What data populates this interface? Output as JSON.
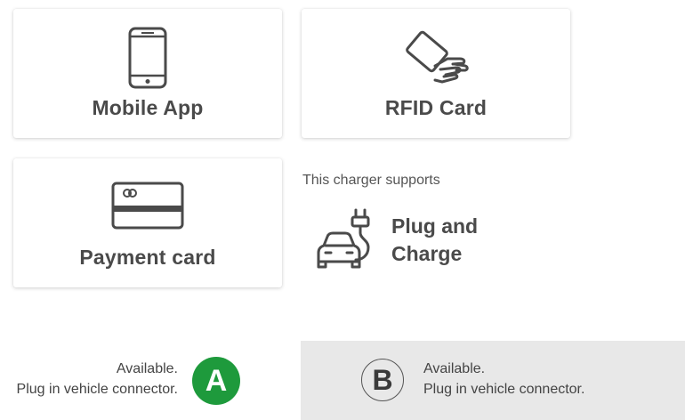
{
  "methods": [
    {
      "id": "mobile",
      "label": "Mobile App",
      "icon": "smartphone-icon"
    },
    {
      "id": "rfid",
      "label": "RFID Card",
      "icon": "rfid-card-tap-icon"
    },
    {
      "id": "payment",
      "label": "Payment card",
      "icon": "credit-card-icon"
    }
  ],
  "supports": {
    "text": "This charger supports",
    "feature_label": "Plug and Charge",
    "icon": "car-plug-icon"
  },
  "connectors": [
    {
      "id": "A",
      "letter": "A",
      "status": "Available.",
      "instruction": "Plug in vehicle connector.",
      "badge_color": "#1e9a3c",
      "selected": true
    },
    {
      "id": "B",
      "letter": "B",
      "status": "Available.",
      "instruction": "Plug in vehicle connector.",
      "badge_color": "#e8e8e8",
      "selected": false
    }
  ],
  "colors": {
    "text": "#4a4a4a",
    "accent_green": "#1e9a3c",
    "panel_gray": "#e8e8e8"
  }
}
